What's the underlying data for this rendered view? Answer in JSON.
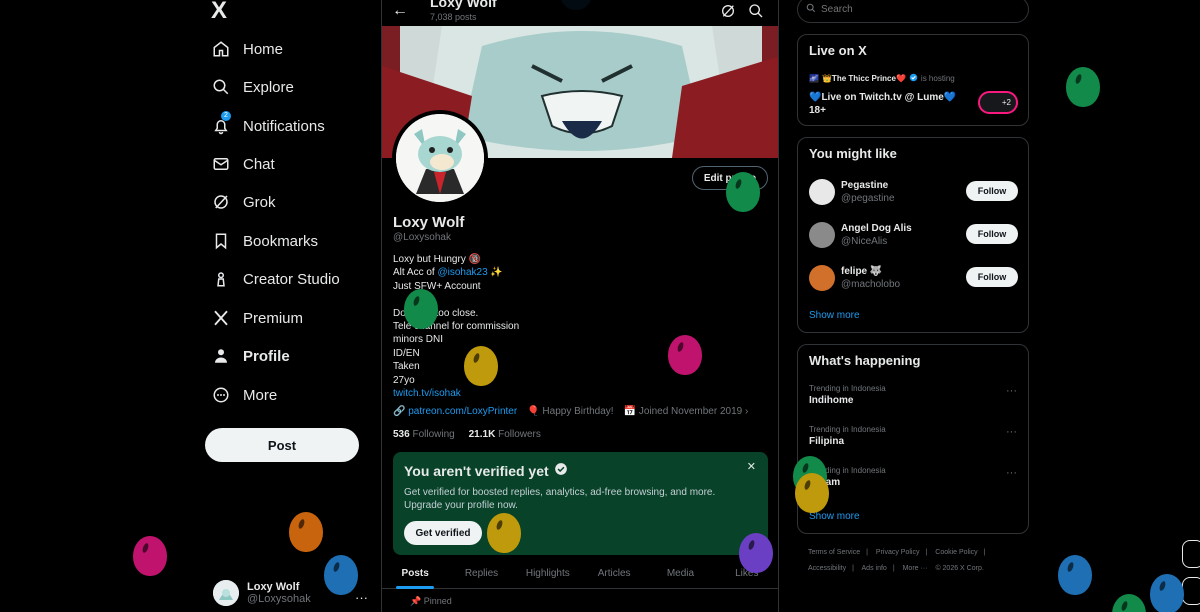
{
  "nav": {
    "logo": "X",
    "items": [
      {
        "label": "Home",
        "icon": "home-icon"
      },
      {
        "label": "Explore",
        "icon": "search-icon"
      },
      {
        "label": "Notifications",
        "icon": "bell-icon",
        "badge": "2"
      },
      {
        "label": "Chat",
        "icon": "mail-icon"
      },
      {
        "label": "Grok",
        "icon": "grok-icon"
      },
      {
        "label": "Bookmarks",
        "icon": "bookmark-icon"
      },
      {
        "label": "Creator Studio",
        "icon": "creator-icon"
      },
      {
        "label": "Premium",
        "icon": "x-premium-icon"
      },
      {
        "label": "Profile",
        "icon": "profile-icon"
      },
      {
        "label": "More",
        "icon": "more-circle-icon"
      }
    ],
    "post_label": "Post",
    "account": {
      "name": "Loxy Wolf",
      "handle": "@Loxysohak",
      "more": "···"
    }
  },
  "profile": {
    "topbar_name": "Loxy Wolf",
    "topbar_posts": "7,038 posts",
    "name": "Loxy Wolf",
    "handle": "@Loxysohak",
    "edit_label": "Edit profile",
    "bio_lines": [
      "Loxy but Hungry 🔞",
      "Alt Acc of @isohak23 ✨",
      "Just SFW+  Account",
      "",
      "Don't get too close.",
      "Tele channel for commission",
      "minors DNI",
      "ID/EN",
      "Taken",
      "27yo"
    ],
    "bio_alt_prefix": "Alt Acc of ",
    "bio_alt_link": "@isohak23",
    "bio_alt_suffix": " ✨",
    "bio_link": "twitch.tv/isohak",
    "website": "patreon.com/LoxyPrinter",
    "birthday": "Happy Birthday!",
    "joined": "Joined November 2019",
    "following_count": "536",
    "following_label": "Following",
    "followers_count": "21.1K",
    "followers_label": "Followers",
    "verify": {
      "title": "You aren't verified yet",
      "desc": "Get verified for boosted replies, analytics, ad-free browsing, and more. Upgrade your profile now.",
      "button": "Get verified",
      "close": "✕"
    },
    "tabs": [
      "Posts",
      "Replies",
      "Highlights",
      "Articles",
      "Media",
      "Likes"
    ],
    "pinned": "Pinned"
  },
  "right": {
    "search_placeholder": "Search",
    "live": {
      "title": "Live on X",
      "host": "👑The Thicc Prince❤️",
      "hosting": "is hosting",
      "stream": "💙Live on Twitch.tv @ Lume💙 18+",
      "extra": "+2"
    },
    "might_like": {
      "title": "You might like",
      "users": [
        {
          "name": "Pegastine",
          "handle": "@pegastine",
          "color": "#e0e0e0"
        },
        {
          "name": "Angel Dog Alis",
          "handle": "@NiceAlis",
          "color": "#9a9a9a"
        },
        {
          "name": "felipe 🐺",
          "handle": "@macholobo",
          "color": "#d0702a"
        }
      ],
      "follow_label": "Follow",
      "show_more": "Show more"
    },
    "happening": {
      "title": "What's happening",
      "trends": [
        {
          "context": "Trending in Indonesia",
          "name": "Indihome"
        },
        {
          "context": "Trending in Indonesia",
          "name": "Filipina"
        },
        {
          "context": "Trending in Indonesia",
          "name": "Malam"
        }
      ],
      "show_more": "Show more"
    },
    "footer": [
      "Terms of Service",
      "|",
      "Privacy Policy",
      "|",
      "Cookie Policy",
      "|",
      "Accessibility",
      "|",
      "Ads info",
      "|",
      "More ···",
      "© 2026 X Corp."
    ]
  },
  "colors": {
    "accent": "#1d9bf0",
    "verify_bg": "#084228",
    "background": "#000000"
  }
}
